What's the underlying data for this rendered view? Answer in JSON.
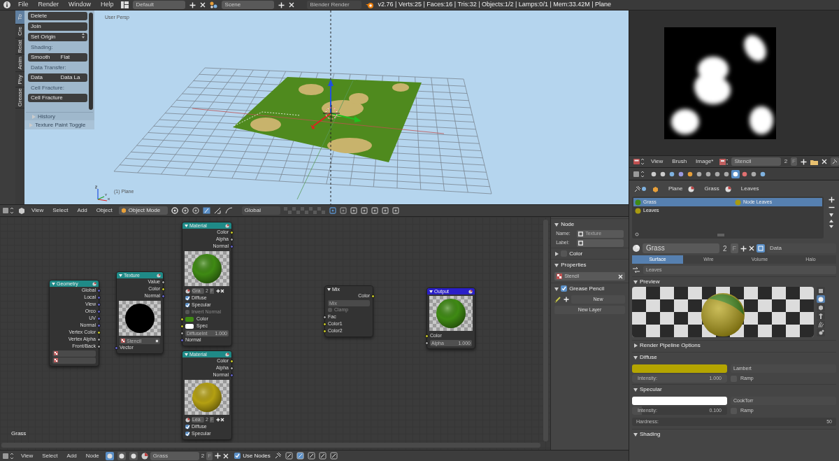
{
  "top_bar": {
    "menus": [
      "File",
      "Render",
      "Window",
      "Help"
    ],
    "screen_layout": "Default",
    "scene": "Scene",
    "render_engine": "Blender Render",
    "stats": "v2.76 | Verts:25 | Faces:16 | Tris:32 | Objects:1/2 | Lamps:0/1 | Mem:33.42M | Plane"
  },
  "toolshelf": {
    "tabs": [
      {
        "label": "To",
        "selected": true
      },
      {
        "label": "Cre",
        "selected": false
      },
      {
        "label": "Relat",
        "selected": false
      },
      {
        "label": "Anim",
        "selected": false
      },
      {
        "label": "Phy",
        "selected": false
      },
      {
        "label": "Grease",
        "selected": false
      }
    ],
    "rows": [
      {
        "kind": "buttons",
        "labels": [
          "Delete"
        ]
      },
      {
        "kind": "buttons",
        "labels": [
          "Join"
        ]
      },
      {
        "kind": "dropdown",
        "labels": [
          "Set Origin"
        ]
      },
      {
        "kind": "heading",
        "labels": [
          "Shading:"
        ]
      },
      {
        "kind": "buttons",
        "labels": [
          "Smooth",
          "Flat"
        ]
      },
      {
        "kind": "heading",
        "labels": [
          "Data Transfer:"
        ]
      },
      {
        "kind": "buttons",
        "labels": [
          "Data",
          "Data La"
        ]
      },
      {
        "kind": "heading",
        "labels": [
          "Cell Fracture:"
        ]
      },
      {
        "kind": "buttons",
        "labels": [
          "Cell Fracture"
        ]
      }
    ],
    "history": {
      "label": "History",
      "expanded": false
    },
    "operator": {
      "label": "Texture Paint Toggle",
      "expanded": false
    }
  },
  "viewport": {
    "view_name": "User Persp",
    "object_label": "(1) Plane"
  },
  "view3d_header": {
    "menus": [
      "View",
      "Select",
      "Add",
      "Object"
    ],
    "mode": "Object Mode",
    "orientation": "Global"
  },
  "node_editor": {
    "material_label": "Grass",
    "nodes": [
      {
        "title": "Geometry",
        "color": "#1f8a87",
        "rows": [
          {
            "kind": "output",
            "label": "Global",
            "color": "#6363c7"
          },
          {
            "kind": "output",
            "label": "Local",
            "color": "#6363c7"
          },
          {
            "kind": "output",
            "label": "View",
            "color": "#6363c7"
          },
          {
            "kind": "output",
            "label": "Orco",
            "color": "#6363c7"
          },
          {
            "kind": "output",
            "label": "UV",
            "color": "#6363c7"
          },
          {
            "kind": "output",
            "label": "Normal",
            "color": "#6363c7"
          },
          {
            "kind": "output",
            "label": "Vertex Color",
            "color": "#c7c729"
          },
          {
            "kind": "output",
            "label": "Vertex Alpha",
            "color": "#a1a1a1"
          },
          {
            "kind": "output",
            "label": "Front/Back",
            "color": "#a1a1a1"
          },
          {
            "kind": "field"
          },
          {
            "kind": "field"
          }
        ]
      },
      {
        "title": "Texture",
        "color": "#1f8a87",
        "rows": [
          {
            "kind": "output",
            "label": "Value",
            "color": "#a1a1a1"
          },
          {
            "kind": "output",
            "label": "Color",
            "color": "#c7c729"
          },
          {
            "kind": "output",
            "label": "Normal",
            "color": "#6363c7"
          },
          {
            "kind": "disc_preview",
            "color": "#000000"
          },
          {
            "kind": "field",
            "text": "Stencil"
          },
          {
            "kind": "input",
            "label": "Vector",
            "color": "#6363c7"
          }
        ]
      },
      {
        "title": "Material",
        "color": "#1f8a87",
        "rows": [
          {
            "kind": "output",
            "label": "Color",
            "color": "#c7c729"
          },
          {
            "kind": "output",
            "label": "Alpha",
            "color": "#a1a1a1"
          },
          {
            "kind": "output",
            "label": "Normal",
            "color": "#6363c7"
          },
          {
            "kind": "sphere_preview",
            "color": "#3f8a14"
          },
          {
            "kind": "datablock",
            "text": "Gra",
            "users": "2",
            "fake": "F"
          },
          {
            "kind": "checkbox",
            "label": "Diffuse",
            "checked": true,
            "disabled": false
          },
          {
            "kind": "checkbox",
            "label": "Specular",
            "checked": true,
            "disabled": false
          },
          {
            "kind": "checkbox",
            "label": "Invert Normal",
            "checked": false,
            "disabled": true
          },
          {
            "kind": "input",
            "label": "Color",
            "color": "#c7c729",
            "swatch": {
              "color": "#3f8a14"
            }
          },
          {
            "kind": "input",
            "label": "Spec",
            "color": "#c7c729",
            "swatch": {
              "color": "#ffffff"
            }
          },
          {
            "kind": "input",
            "label": "DiffuseInt",
            "color": "#a1a1a1",
            "value": "1.000",
            "level": 1
          },
          {
            "kind": "input",
            "label": "Normal",
            "color": "#6363c7"
          }
        ]
      },
      {
        "title": "Material",
        "color": "#1f8a87",
        "rows": [
          {
            "kind": "output",
            "label": "Color",
            "color": "#c7c729"
          },
          {
            "kind": "output",
            "label": "Alpha",
            "color": "#a1a1a1"
          },
          {
            "kind": "output",
            "label": "Normal",
            "color": "#6363c7"
          },
          {
            "kind": "sphere_preview",
            "color": "#b4a012"
          },
          {
            "kind": "datablock",
            "text": "Lea",
            "users": "2",
            "fake": "F"
          },
          {
            "kind": "checkbox",
            "label": "Diffuse",
            "checked": true,
            "disabled": false
          },
          {
            "kind": "checkbox",
            "label": "Specular",
            "checked": true,
            "disabled": false
          }
        ]
      },
      {
        "title": "Mix",
        "color": "#333333",
        "rows": [
          {
            "kind": "output",
            "label": "Color",
            "color": "#c7c729"
          },
          {
            "kind": "dropdown",
            "text": "Mix"
          },
          {
            "kind": "checkbox",
            "label": "Clamp",
            "checked": false,
            "disabled": true
          },
          {
            "kind": "input",
            "label": "Fac",
            "color": "#a1a1a1"
          },
          {
            "kind": "input",
            "label": "Color1",
            "color": "#c7c729"
          },
          {
            "kind": "input",
            "label": "Color2",
            "color": "#c7c729"
          }
        ]
      },
      {
        "title": "Output",
        "color": "#2a1fc8",
        "rows": [
          {
            "kind": "sphere_preview",
            "color": "#3f8a14"
          },
          {
            "kind": "input",
            "label": "Color",
            "color": "#c7c729"
          },
          {
            "kind": "input",
            "label": "Alpha",
            "color": "#a1a1a1",
            "value": "1.000",
            "level": 1
          }
        ]
      }
    ]
  },
  "node_sidebar": {
    "node_panel": {
      "title": "Node",
      "expanded": true,
      "name_label": "Name:",
      "name": "Texture",
      "label_label": "Label:"
    },
    "color_panel": {
      "title": "Color",
      "expanded": false,
      "enabled": false
    },
    "properties_panel": {
      "title": "Properties",
      "expanded": true,
      "texture": "Stencil"
    },
    "grease_pencil_panel": {
      "title": "Grease Pencil",
      "expanded": true,
      "enabled": true,
      "new_button": "New",
      "new_layer_button": "New Layer"
    }
  },
  "node_header": {
    "menus": [
      "View",
      "Select",
      "Add",
      "Node"
    ],
    "material": "Grass",
    "users": "2",
    "fake_user": "F",
    "use_nodes": {
      "label": "Use Nodes",
      "checked": true
    }
  },
  "image_editor": {
    "menus": [
      "View",
      "Brush",
      "Image*"
    ],
    "image": "Stencil",
    "users": "2",
    "fake_user": "F"
  },
  "properties": {
    "context_tabs": [
      {
        "selected": false
      },
      {
        "selected": false
      },
      {
        "selected": false
      },
      {
        "selected": false
      },
      {
        "selected": false
      },
      {
        "selected": false
      },
      {
        "selected": false
      },
      {
        "selected": false
      },
      {
        "selected": false
      },
      {
        "selected": true
      },
      {
        "selected": false
      },
      {
        "selected": false
      },
      {
        "selected": false
      }
    ],
    "breadcrumbs": [
      "Plane",
      "Grass",
      "Leaves"
    ],
    "slots": [
      {
        "label": "Grass",
        "selected": true,
        "color": "#3f8a14"
      },
      {
        "label": "Leaves",
        "selected": false,
        "color": "#a89a10"
      }
    ],
    "active_node_material": "Node Leaves",
    "material": "Grass",
    "users": "2",
    "fake_user": "F",
    "data_link": "Data",
    "tabs": [
      {
        "label": "Surface",
        "selected": true
      },
      {
        "label": "Wire",
        "selected": false
      },
      {
        "label": "Volume",
        "selected": false
      },
      {
        "label": "Halo",
        "selected": false
      }
    ],
    "node_material": "Leaves",
    "panels": [
      {
        "kind": "preview",
        "title": "Preview",
        "expanded": true,
        "shapes": [
          {
            "selected": false
          },
          {
            "selected": true
          },
          {
            "selected": false
          },
          {
            "selected": false
          },
          {
            "selected": false
          },
          {
            "selected": false
          }
        ]
      },
      {
        "kind": "plain",
        "title": "Render Pipeline Options",
        "expanded": false
      },
      {
        "kind": "shader",
        "title": "Diffuse",
        "expanded": true,
        "color": "#b4a500",
        "shader": "Lambert",
        "intensity_label": "Intensity:",
        "intensity": "1.000",
        "level": 1,
        "ramp": {
          "label": "Ramp",
          "checked": false
        }
      },
      {
        "kind": "shader",
        "title": "Specular",
        "expanded": true,
        "color": "#ffffff",
        "shader": "CookTorr",
        "intensity_label": "Intensity:",
        "intensity": "0.100",
        "level": 0.1,
        "ramp": {
          "label": "Ramp",
          "checked": false
        },
        "hardness_label": "Hardness:",
        "hardness": "50"
      },
      {
        "kind": "plain",
        "title": "Shading",
        "expanded": true
      }
    ]
  }
}
